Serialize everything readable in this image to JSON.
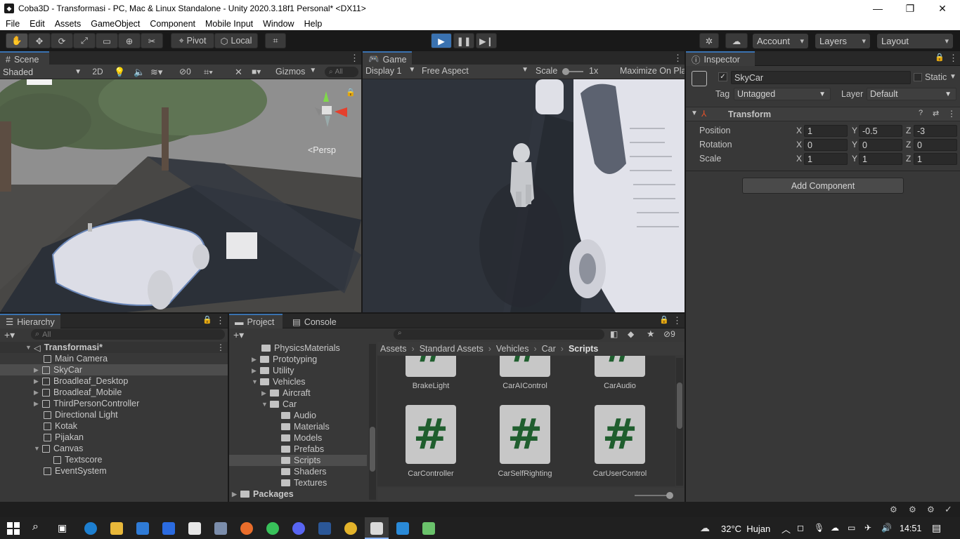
{
  "window": {
    "title": "Coba3D - Transformasi - PC, Mac & Linux Standalone - Unity 2020.3.18f1 Personal* <DX11>"
  },
  "menu": [
    "File",
    "Edit",
    "Assets",
    "GameObject",
    "Component",
    "Mobile Input",
    "Window",
    "Help"
  ],
  "toolbar": {
    "pivot": "Pivot",
    "local": "Local",
    "account": "Account",
    "layers": "Layers",
    "layout": "Layout"
  },
  "scene": {
    "tab": "Scene",
    "shading": "Shaded",
    "mode2d": "2D",
    "gizmos": "Gizmos",
    "search": "All",
    "persp": "<Persp",
    "hidden_count": "0"
  },
  "game": {
    "tab": "Game",
    "display": "Display 1",
    "aspect": "Free Aspect",
    "scale_label": "Scale",
    "scale_value": "1x",
    "maximize": "Maximize On Pla"
  },
  "inspector": {
    "tab": "Inspector",
    "object_name": "SkyCar",
    "static_label": "Static",
    "tag_label": "Tag",
    "tag_value": "Untagged",
    "layer_label": "Layer",
    "layer_value": "Default",
    "component": "Transform",
    "position": {
      "label": "Position",
      "x": "1",
      "y": "-0.5",
      "z": "-3"
    },
    "rotation": {
      "label": "Rotation",
      "x": "0",
      "y": "0",
      "z": "0"
    },
    "scale": {
      "label": "Scale",
      "x": "1",
      "y": "1",
      "z": "1"
    },
    "axis_x": "X",
    "axis_y": "Y",
    "axis_z": "Z",
    "add_component": "Add Component"
  },
  "hierarchy": {
    "tab": "Hierarchy",
    "search": "All",
    "scene": "Transformasi*",
    "items": [
      "Main Camera",
      "SkyCar",
      "Broadleaf_Desktop",
      "Broadleaf_Mobile",
      "ThirdPersonController",
      "Directional Light",
      "Kotak",
      "Pijakan",
      "Canvas",
      "Textscore",
      "EventSystem"
    ]
  },
  "project": {
    "tab": "Project",
    "console_tab": "Console",
    "hidden_count": "9",
    "tree": [
      "PhysicsMaterials",
      "Prototyping",
      "Utility",
      "Vehicles",
      "Aircraft",
      "Car",
      "Audio",
      "Materials",
      "Models",
      "Prefabs",
      "Scripts",
      "Shaders",
      "Textures",
      "Packages"
    ],
    "breadcrumb": [
      "Assets",
      "Standard Assets",
      "Vehicles",
      "Car",
      "Scripts"
    ],
    "assets_top": [
      "BrakeLight",
      "CarAIControl",
      "CarAudio"
    ],
    "assets": [
      "CarController",
      "CarSelfRighting",
      "CarUserControl"
    ],
    "script_glyph": "#"
  },
  "taskbar": {
    "weather": "32°C  Hujan",
    "time": "14:51"
  },
  "colors": {
    "accent": "#3a72b0",
    "panel": "#383838",
    "dark": "#191919"
  }
}
